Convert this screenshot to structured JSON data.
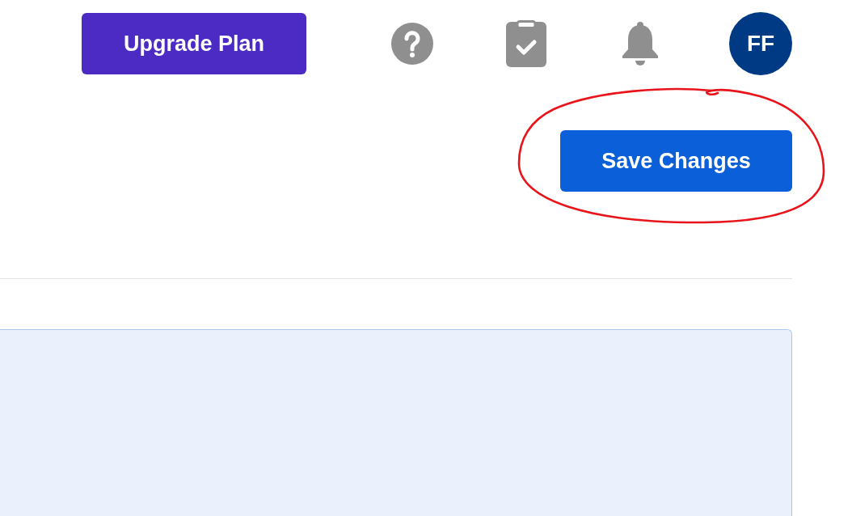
{
  "header": {
    "upgrade_button": {
      "label": "Upgrade Plan"
    },
    "icons": [
      {
        "kind": "help"
      },
      {
        "kind": "clipboard"
      },
      {
        "kind": "bell"
      }
    ],
    "avatar": {
      "initials": "FF"
    }
  },
  "save_button": {
    "label": "Save Changes",
    "circled": true
  }
}
